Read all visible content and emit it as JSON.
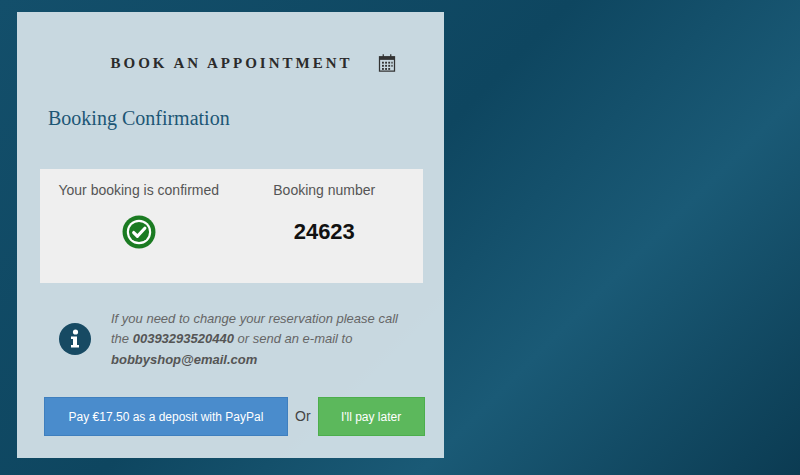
{
  "header": {
    "title": "BOOK AN APPOINTMENT"
  },
  "heading": "Booking Confirmation",
  "summary": [
    {
      "label": "Your booking is confirmed",
      "kind": "icon"
    },
    {
      "label": "Booking number",
      "kind": "value",
      "value": "24623"
    }
  ],
  "info": {
    "parts": [
      {
        "text": "If you need to change your reservation please call the ",
        "bold": false
      },
      {
        "text": "00393293520440",
        "bold": true
      },
      {
        "text": " or send an e-mail to ",
        "bold": false
      },
      {
        "text": "bobbyshop@email.com",
        "bold": true
      }
    ]
  },
  "actions": {
    "pay_button": "Pay €17.50 as a deposit with PayPal",
    "separator": "Or",
    "later_button": "I'll pay later"
  }
}
